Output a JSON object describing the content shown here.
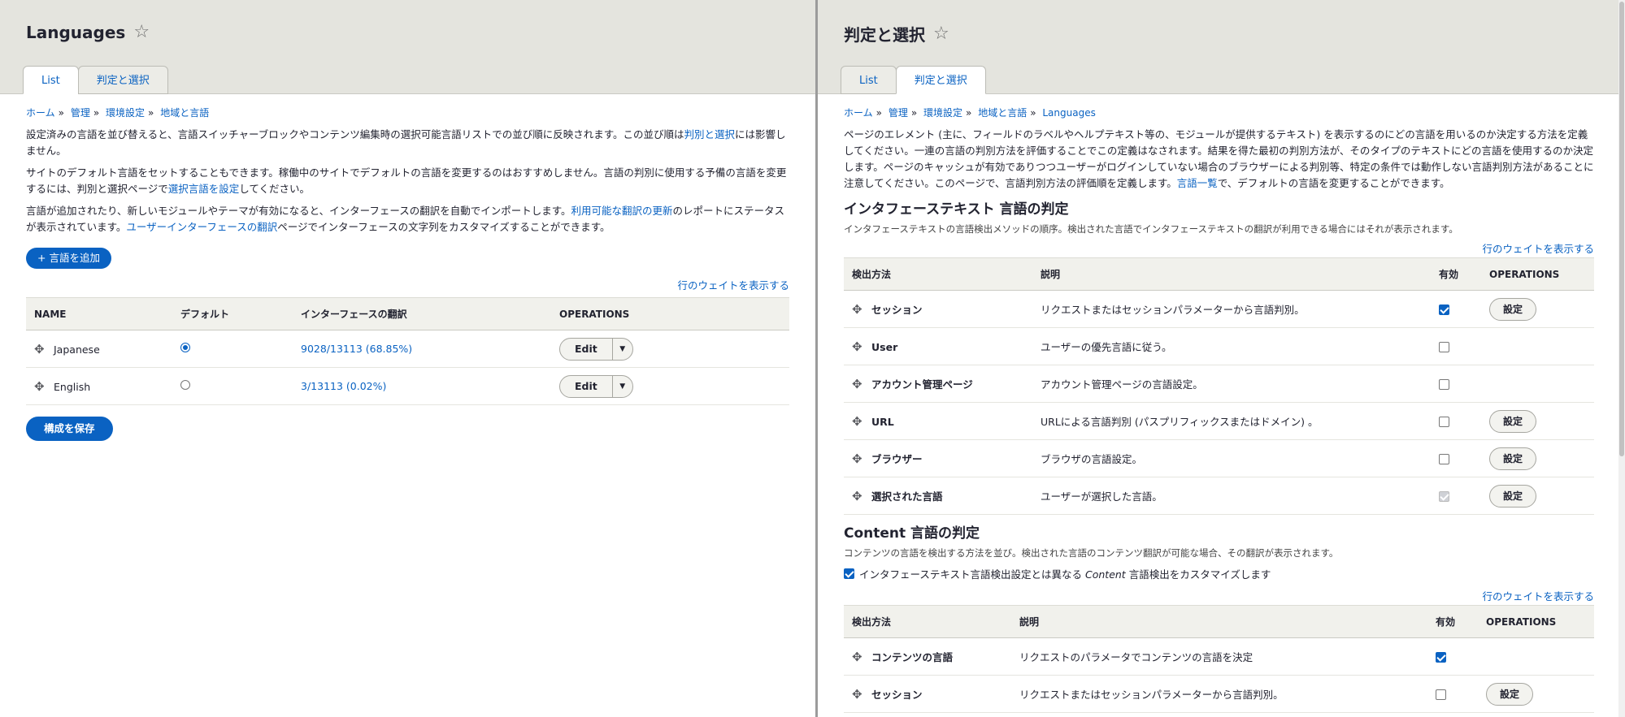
{
  "left": {
    "title": "Languages",
    "tabs": [
      "List",
      "判定と選択"
    ],
    "breadcrumb": [
      "ホーム",
      "管理",
      "環境設定",
      "地域と言語"
    ],
    "p1_text": "設定済みの言語を並び替えると、言語スイッチャーブロックやコンテンツ編集時の選択可能言語リストでの並び順に反映されます。この並び順は",
    "p1_link": "判別と選択",
    "p1_tail": "には影響しません。",
    "p2_text": "サイトのデフォルト言語をセットすることもできます。稼働中のサイトでデフォルトの言語を変更するのはおすすめしません。言語の判別に使用する予備の言語を変更するには、判別と選択ページで",
    "p2_link": "選択言語を設定",
    "p2_tail": "してください。",
    "p3_text": "言語が追加されたり、新しいモジュールやテーマが有効になると、インターフェースの翻訳を自動でインポートします。",
    "p3_link1": "利用可能な翻訳の更新",
    "p3_mid": "のレポートにステータスが表示されています。",
    "p3_link2": "ユーザーインターフェースの翻訳",
    "p3_tail": "ページでインターフェースの文字列をカスタマイズすることができます。",
    "add_button": "+ 言語を追加",
    "show_weights": "行のウェイトを表示する",
    "table": {
      "headers": [
        "NAME",
        "デフォルト",
        "インターフェースの翻訳",
        "OPERATIONS"
      ],
      "rows": [
        {
          "name": "Japanese",
          "translation": "9028/13113 (68.85%)",
          "op": "Edit"
        },
        {
          "name": "English",
          "translation": "3/13113 (0.02%)",
          "op": "Edit"
        }
      ]
    },
    "save_button": "構成を保存"
  },
  "right": {
    "title": "判定と選択",
    "tabs": [
      "List",
      "判定と選択"
    ],
    "breadcrumb": [
      "ホーム",
      "管理",
      "環境設定",
      "地域と言語",
      "Languages"
    ],
    "intro_text": "ページのエレメント (主に、フィールドのラベルやヘルプテキスト等の、モジュールが提供するテキスト) を表示するのにどの言語を用いるのか決定する方法を定義してください。一連の言語の判別方法を評価することでこの定義はなされます。結果を得た最初の判別方法が、そのタイプのテキストにどの言語を使用するのか決定します。ページのキャッシュが有効でありつつユーザーがログインしていない場合のブラウザーによる判別等、特定の条件では動作しない言語判別方法があることに注意してください。このページで、言語判別方法の評価順を定義します。",
    "intro_link": "言語一覧",
    "intro_tail": "で、デフォルトの言語を変更することができます。",
    "interface_section": {
      "title": "インタフェーステキスト 言語の判定",
      "desc": "インタフェーステキストの言語検出メソッドの順序。検出された言語でインタフェーステキストの翻訳が利用できる場合にはそれが表示されます。",
      "show_weights": "行のウェイトを表示する",
      "headers": [
        "検出方法",
        "説明",
        "有効",
        "OPERATIONS"
      ],
      "rows": [
        {
          "method": "セッション",
          "desc": "リクエストまたはセッションパラメーターから言語判別。",
          "op": "設定"
        },
        {
          "method": "User",
          "desc": "ユーザーの優先言語に従う。",
          "op": ""
        },
        {
          "method": "アカウント管理ページ",
          "desc": "アカウント管理ページの言語設定。",
          "op": ""
        },
        {
          "method": "URL",
          "desc": "URLによる言語判別 (パスプリフィックスまたはドメイン) 。",
          "op": "設定"
        },
        {
          "method": "ブラウザー",
          "desc": "ブラウザの言語設定。",
          "op": "設定"
        },
        {
          "method": "選択された言語",
          "desc": "ユーザーが選択した言語。",
          "op": "設定"
        }
      ]
    },
    "content_section": {
      "title": "Content 言語の判定",
      "desc": "コンテンツの言語を検出する方法を並び。検出された言語のコンテンツ翻訳が可能な場合、その翻訳が表示されます。",
      "customize_label_pre": "インタフェーステキスト言語検出設定とは異なる",
      "customize_label_em": "Content",
      "customize_label_post": "言語検出をカスタマイズします",
      "show_weights": "行のウェイトを表示する",
      "headers": [
        "検出方法",
        "説明",
        "有効",
        "OPERATIONS"
      ],
      "rows": [
        {
          "method": "コンテンツの言語",
          "desc": "リクエストのパラメータでコンテンツの言語を決定",
          "op": ""
        },
        {
          "method": "セッション",
          "desc": "リクエストまたはセッションパラメーターから言語判別。",
          "op": "設定"
        }
      ]
    }
  }
}
